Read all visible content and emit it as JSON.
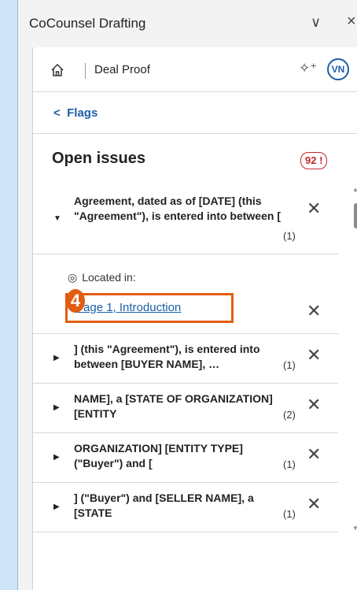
{
  "window": {
    "title": "CoCounsel Drafting",
    "chevron": "∨",
    "close": "×"
  },
  "header": {
    "doc_title": "Deal Proof",
    "avatar_initials": "VN"
  },
  "subnav": {
    "back_label": "Flags"
  },
  "issues": {
    "title": "Open issues",
    "count": "92 !",
    "items": [
      {
        "text": "Agreement, dated as of [DATE] (this \"Agreement\"), is entered into between [",
        "count": "(1)",
        "expanded": true
      },
      {
        "text": "] (this \"Agreement\"), is entered into between [BUYER NAME], …",
        "count": "(1)",
        "expanded": false
      },
      {
        "text": "NAME], a [STATE OF ORGANIZATION] [ENTITY",
        "count": "(2)",
        "expanded": false
      },
      {
        "text": "ORGANIZATION] [ENTITY TYPE] (\"Buyer\") and [",
        "count": "(1)",
        "expanded": false
      },
      {
        "text": "] (\"Buyer\") and [SELLER NAME], a [STATE",
        "count": "(1)",
        "expanded": false
      }
    ],
    "located_label": "Located in:",
    "location_link": "Page 1, Introduction"
  },
  "annotation": {
    "step_number": "4",
    "highlight_color": "#e15d12"
  },
  "colors": {
    "accent": "#1a5fa8",
    "badge_red": "#c4262e"
  },
  "icons": {
    "home": "home-icon",
    "sparkle": "sparkle-icon",
    "pin": "location-pin-icon"
  }
}
